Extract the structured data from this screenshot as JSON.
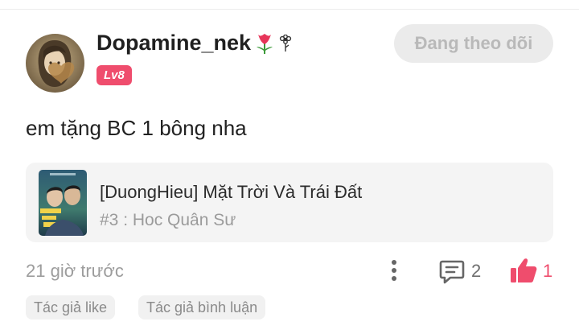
{
  "post": {
    "username": "Dopamine_nek",
    "level": "Lv8",
    "follow_label": "Đang theo dõi",
    "comment": "em tặng BC 1 bông nha",
    "story": {
      "title": "[DuongHieu] Mặt Trời Và Trái Đất",
      "chapter": "#3 : Hoc Quân Sư"
    },
    "time": "21 giờ trước",
    "comment_count": "2",
    "like_count": "1",
    "tags": [
      "Tác giả like",
      "Tác giả bình luận"
    ]
  },
  "colors": {
    "accent": "#ef4d6d",
    "follow_bg": "#ebebeb",
    "card_bg": "#f4f4f4"
  },
  "icons": [
    "avatar",
    "tulip-icon",
    "flower-icon",
    "more-icon",
    "comment-icon",
    "thumbs-up-icon"
  ]
}
